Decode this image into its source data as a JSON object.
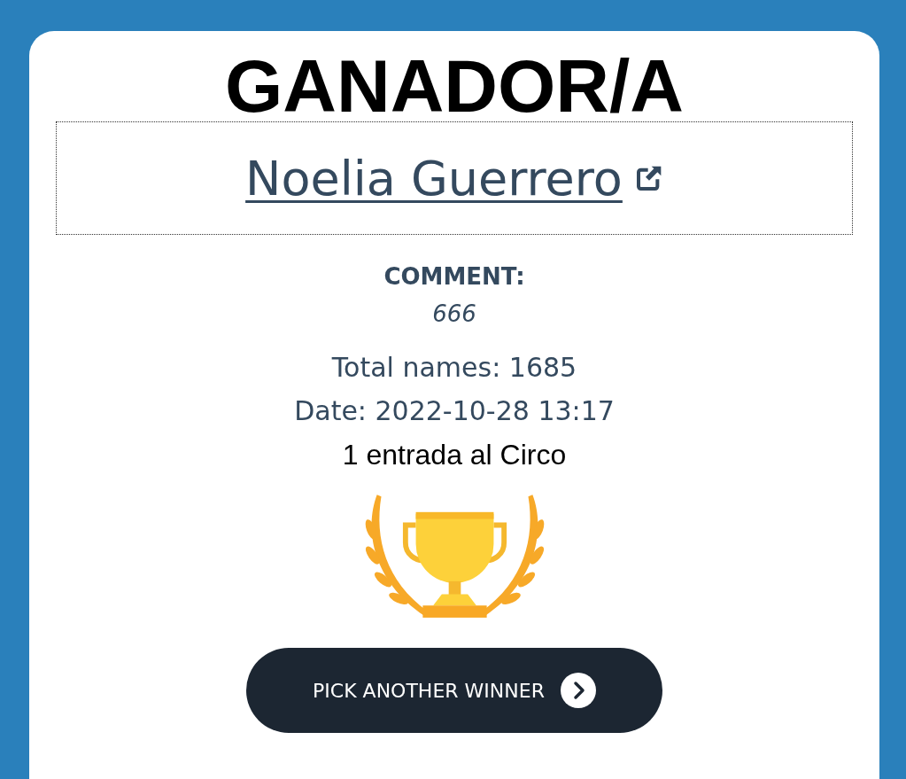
{
  "title": "GANADOR/A",
  "winner": {
    "name": "Noelia Guerrero"
  },
  "comment": {
    "label": "COMMENT:",
    "text": "666"
  },
  "total_names": "Total names: 1685",
  "date": "Date: 2022-10-28 13:17",
  "prize": "1 entrada al Circo",
  "button": {
    "label": "PICK ANOTHER WINNER"
  }
}
